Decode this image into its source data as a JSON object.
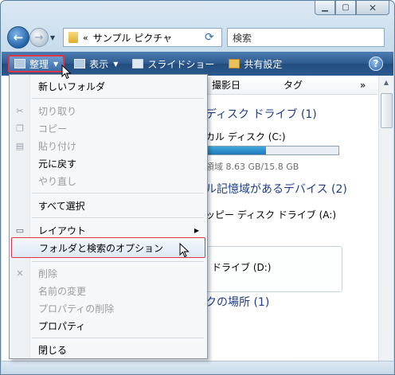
{
  "window": {
    "address": {
      "separator": "«",
      "path": "サンプル ピクチャ"
    },
    "search_placeholder": "検索"
  },
  "cmdbar": {
    "organize": "整理",
    "view": "表示",
    "slideshow": "スライドショー",
    "share": "共有設定",
    "help": "?"
  },
  "columns": {
    "date": "撮影日",
    "tag": "タグ",
    "more": "»"
  },
  "content": {
    "group_hdd": "ディスク ドライブ (1)",
    "local_disk": "カル ディスク (C:)",
    "free_space": "領域 8.63 GB/15.8 GB",
    "capacity_fraction": 0.45,
    "group_removable": "ル記憶域があるデバイス (2)",
    "floppy": "ッピー ディスク ドライブ (A:)",
    "dvd": "ドライブ (D:)",
    "group_network": "クの場所 (1)"
  },
  "menu": {
    "new_folder": "新しいフォルダ",
    "cut": "切り取り",
    "copy": "コピー",
    "paste": "貼り付け",
    "undo": "元に戻す",
    "redo": "やり直し",
    "select_all": "すべて選択",
    "layout": "レイアウト",
    "folder_options": "フォルダと検索のオプション",
    "delete": "削除",
    "rename": "名前の変更",
    "remove_props": "プロパティの削除",
    "properties": "プロパティ",
    "close": "閉じる"
  },
  "colors": {
    "accent": "#1e3e87",
    "cmdbar": "#2d5a8e",
    "highlight_border": "#e0344a"
  }
}
